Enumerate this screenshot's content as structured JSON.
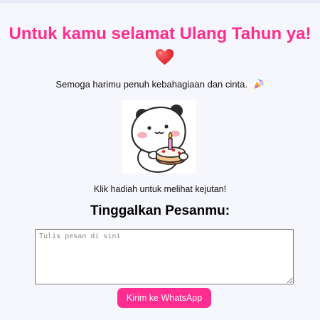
{
  "header": {
    "title": "Untuk kamu selamat Ulang Tahun ya!",
    "heart_icon": "heart-icon"
  },
  "greeting": {
    "message": "Semoga harimu penuh kebahagiaan dan cinta.",
    "emoji_icon": "party-popper-icon"
  },
  "sticker": {
    "icon": "panda-birthday-cake-sticker"
  },
  "gift": {
    "hint": "Klik hadiah untuk melihat kejutan!"
  },
  "message_form": {
    "heading": "Tinggalkan Pesanmu:",
    "placeholder": "Tulis pesan di sini",
    "value": "",
    "submit_label": "Kirim ke WhatsApp"
  },
  "colors": {
    "accent": "#ff2d8f",
    "background": "#f6f7fc",
    "heart": "#e8262f"
  }
}
